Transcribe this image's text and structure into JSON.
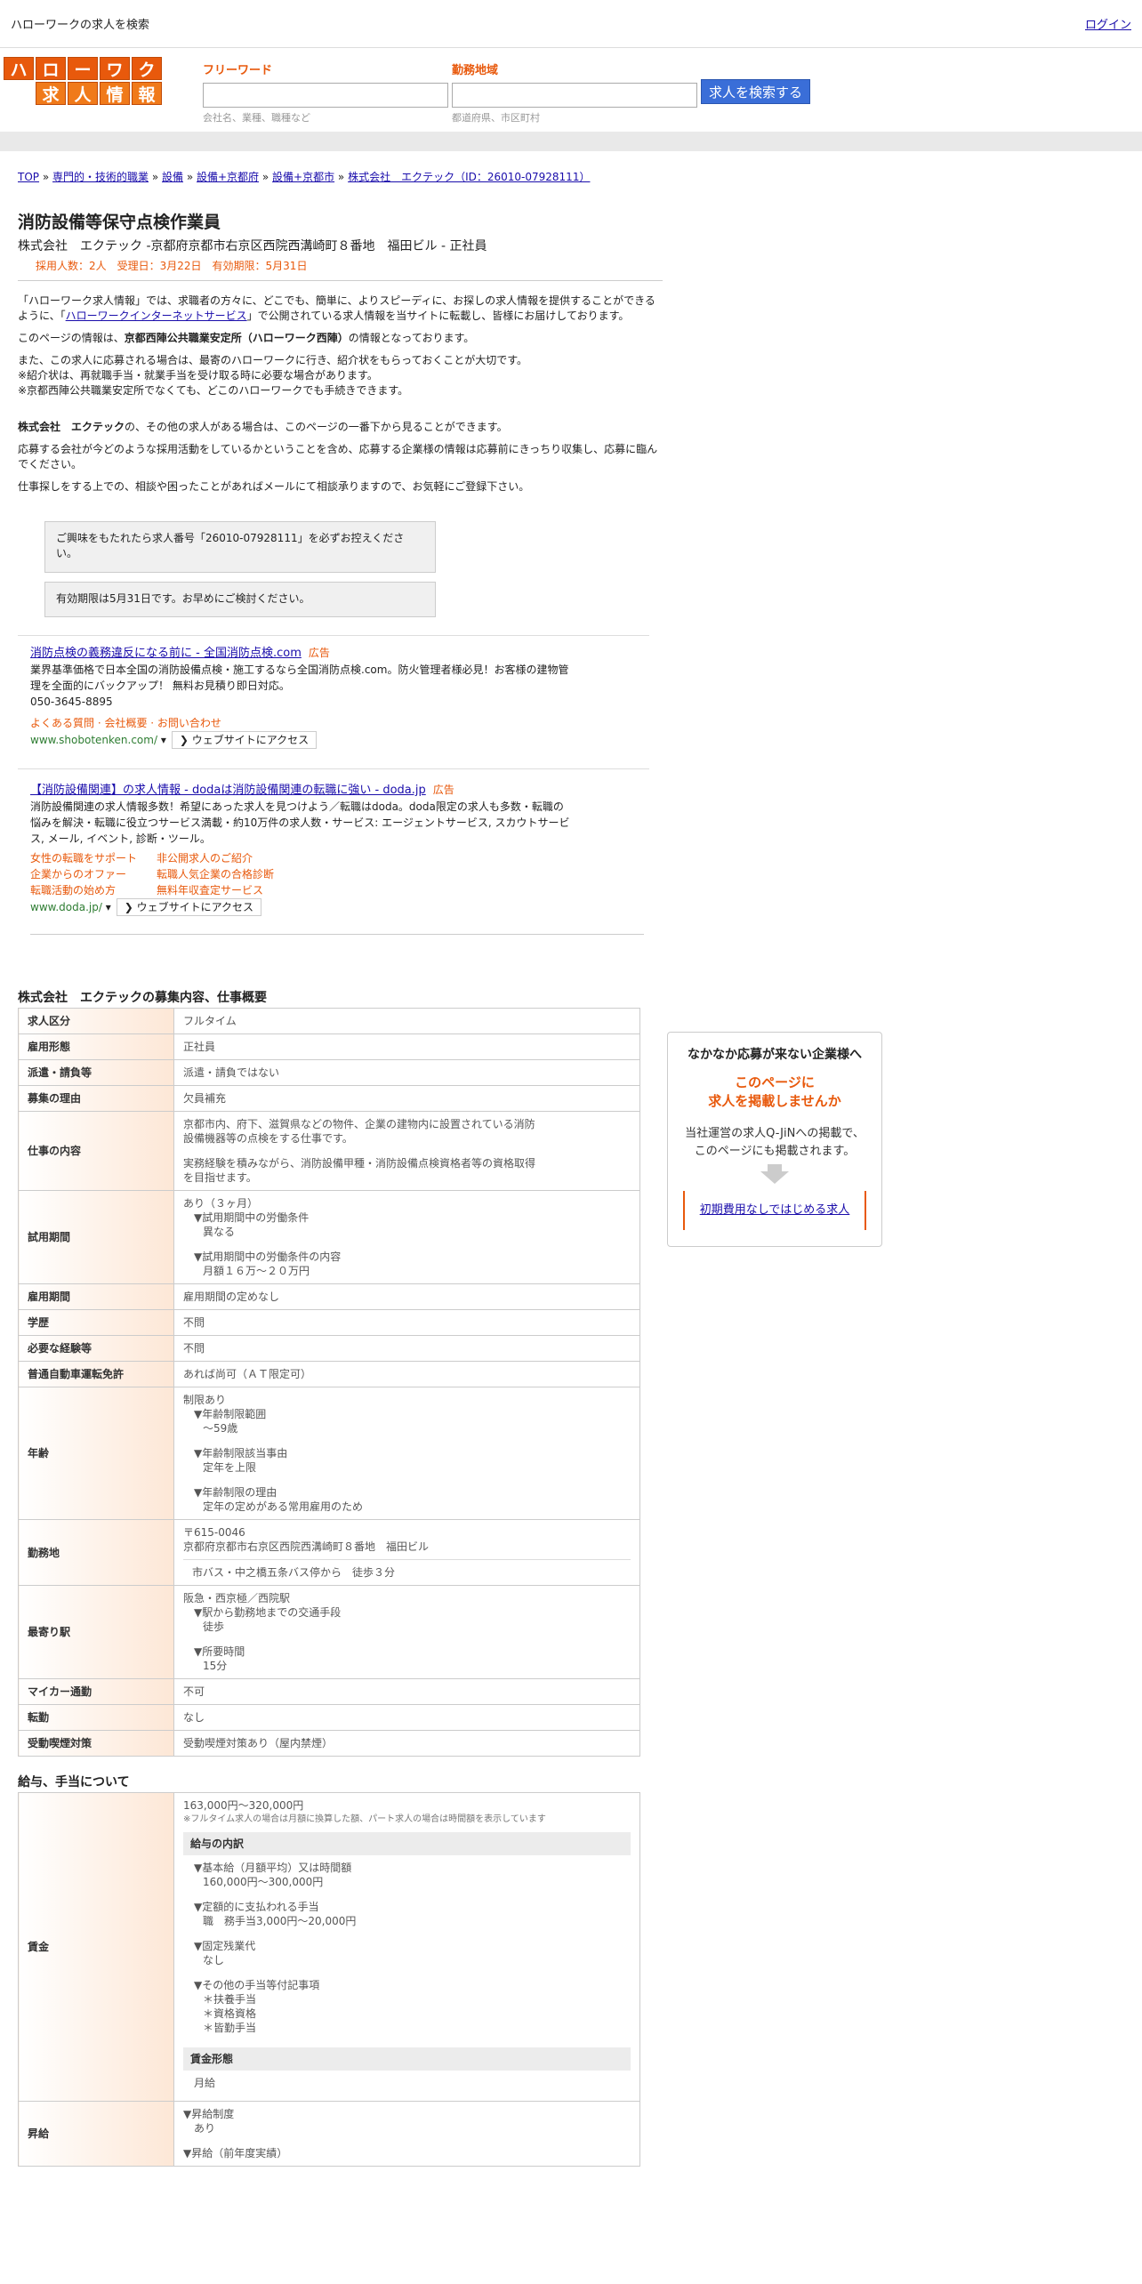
{
  "topbar": {
    "title": "ハローワークの求人を検索",
    "login": "ログイン"
  },
  "logo": {
    "row1": [
      "ハ",
      "ロ",
      "ー",
      "ワ",
      "ー",
      "ク"
    ],
    "row2": [
      "求",
      "人",
      "情",
      "報"
    ]
  },
  "search": {
    "keyword_label": "フリーワード",
    "keyword_placeholder": "会社名、業種、職種など",
    "area_label": "勤務地域",
    "area_placeholder": "都道府県、市区町村",
    "button": "求人を検索する"
  },
  "breadcrumb": [
    "TOP",
    "専門的・技術的職業",
    "設備",
    "設備+京都府",
    "設備+京都市",
    "株式会社　エクテック（ID：26010-07928111）"
  ],
  "job": {
    "title": "消防設備等保守点検作業員",
    "subtitle": "株式会社　エクテック -京都府京都市右京区西院西溝崎町８番地　福田ビル - 正社員",
    "meta": "採用人数：2人　受理日：3月22日　有効期限：5月31日"
  },
  "intro": {
    "p1a": "「ハローワーク求人情報」では、求職者の方々に、どこでも、簡単に、よりスピーディに、お探しの求人情報を提供することができるように、「",
    "p1link": "ハローワークインターネットサービス",
    "p1b": "」で公開されている求人情報を当サイトに転載し、皆様にお届けしております。",
    "p2a": "このページの情報は、",
    "p2b": "京都西陣公共職業安定所（ハローワーク西陣）",
    "p2c": "の情報となっております。",
    "p3": "また、この求人に応募される場合は、最寄のハローワークに行き、紹介状をもらっておくことが大切です。",
    "p4": "※紹介状は、再就職手当・就業手当を受け取る時に必要な場合があります。",
    "p5": "※京都西陣公共職業安定所でなくても、どこのハローワークでも手続きできます。",
    "p6a": "株式会社　エクテック",
    "p6b": "の、その他の求人がある場合は、このページの一番下から見ることができます。",
    "p7": "応募する会社が今どのような採用活動をしているかということを含め、応募する企業様の情報は応募前にきっちり収集し、応募に臨んでください。",
    "p8": "仕事探しをする上での、相談や困ったことがあればメールにて相談承りますので、お気軽にご登録下さい。"
  },
  "notices": [
    "ご興味をもたれたら求人番号「26010-07928111」を必ずお控えください。",
    "有効期限は5月31日です。お早めにご検討ください。"
  ],
  "ads": [
    {
      "title": "消防点検の義務違反になる前に - 全国消防点検.com",
      "tag": "広告",
      "desc": "業界基準価格で日本全国の消防設備点検・施工するなら全国消防点検.com。防火管理者様必見！お客様の建物管理を全面的にバックアップ！ 無料お見積り即日対応。",
      "phone": "050-3645-8895",
      "links": "よくある質問 · 会社概要 · お問い合わせ",
      "url": "www.shobotenken.com/",
      "button": "❯ ウェブサイトにアクセス"
    },
    {
      "title": "【消防設備関連】の求人情報 - dodaは消防設備関連の転職に強い - doda.jp",
      "tag": "広告",
      "desc": "消防設備関連の求人情報多数！希望にあった求人を見つけよう／転職はdoda。doda限定の求人も多数・転職の悩みを解決・転職に役立つサービス満載・約10万件の求人数・サービス: エージェントサービス, スカウトサービス, メール, イベント, 診断・ツール。",
      "grid": [
        "女性の転職をサポート",
        "非公開求人のご紹介",
        "企業からのオファー",
        "転職人気企業の合格診断",
        "転職活動の始め方",
        "無料年収査定サービス"
      ],
      "url": "www.doda.jp/",
      "button": "❯ ウェブサイトにアクセス"
    }
  ],
  "section1": {
    "heading": "株式会社　エクテックの募集内容、仕事概要",
    "rows": {
      "kubun": {
        "k": "求人区分",
        "v": "フルタイム"
      },
      "keitai": {
        "k": "雇用形態",
        "v": "正社員"
      },
      "haken": {
        "k": "派遣・請負等",
        "v": "派遣・請負ではない"
      },
      "riyu": {
        "k": "募集の理由",
        "v": "欠員補充"
      },
      "naiyo": {
        "k": "仕事の内容",
        "v1": "京都市内、府下、滋賀県などの物件、企業の建物内に設置されている消防設備機器等の点検をする仕事です。",
        "v2": "実務経験を積みながら、消防設備甲種・消防設備点検資格者等の資格取得を目指せます。"
      },
      "shiyo": {
        "k": "試用期間",
        "a": "あり（３ヶ月）",
        "b": "▼試用期間中の労働条件",
        "c": "異なる",
        "d": "▼試用期間中の労働条件の内容",
        "e": "月額１６万～２０万円"
      },
      "koyokikan": {
        "k": "雇用期間",
        "v": "雇用期間の定めなし"
      },
      "gakureki": {
        "k": "学歴",
        "v": "不問"
      },
      "keiken": {
        "k": "必要な経験等",
        "v": "不問"
      },
      "menkyo": {
        "k": "普通自動車運転免許",
        "v": "あれば尚可（ＡＴ限定可）"
      },
      "nenrei": {
        "k": "年齢",
        "a": "制限あり",
        "b": "▼年齢制限範囲",
        "c": "〜59歳",
        "d": "▼年齢制限該当事由",
        "e": "定年を上限",
        "f": "▼年齢制限の理由",
        "g": "定年の定めがある常用雇用のため"
      },
      "kinmuchi": {
        "k": "勤務地",
        "a": "〒615-0046",
        "b": "京都府京都市右京区西院西溝崎町８番地　福田ビル",
        "c": "市バス・中之橋五条バス停から　徒歩３分"
      },
      "moyori": {
        "k": "最寄り駅",
        "a": "阪急・西京極／西院駅",
        "b": "▼駅から勤務地までの交通手段",
        "c": "徒歩",
        "d": "▼所要時間",
        "e": "15分"
      },
      "mycar": {
        "k": "マイカー通勤",
        "v": "不可"
      },
      "tenkin": {
        "k": "転勤",
        "v": "なし"
      },
      "judo": {
        "k": "受動喫煙対策",
        "v": "受動喫煙対策あり（屋内禁煙）"
      }
    }
  },
  "section2": {
    "heading": "給与、手当について",
    "chingin": {
      "k": "賃金",
      "range": "163,000円〜320,000円",
      "note": "※フルタイム求人の場合は月額に換算した額、パート求人の場合は時間額を表示しています",
      "sub1": "給与の内訳",
      "a": "▼基本給（月額平均）又は時間額",
      "b": "160,000円〜300,000円",
      "c": "▼定額的に支払われる手当",
      "d": "職　務手当3,000円〜20,000円",
      "e": "▼固定残業代",
      "f": "なし",
      "g": "▼その他の手当等付記事項",
      "h1": "＊扶養手当",
      "h2": "＊資格資格",
      "h3": "＊皆勤手当",
      "sub2": "賃金形態",
      "i": "月給"
    },
    "shokyu": {
      "k": "昇給",
      "a": "▼昇給制度",
      "b": "あり",
      "c": "▼昇給（前年度実績）"
    }
  },
  "side": {
    "t1": "なかなか応募が来ない企業様へ",
    "t2a": "このページに",
    "t2b": "求人を掲載しませんか",
    "t3a": "当社運営の求人Q-JiNへの掲載で、",
    "t3b": "このページにも掲載されます。",
    "button": "初期費用なしではじめる求人"
  },
  "colors": {
    "accent": "#e8590c",
    "link": "#1a0dab",
    "button": "#3a6ed8",
    "ad_url": "#2e7d32"
  }
}
